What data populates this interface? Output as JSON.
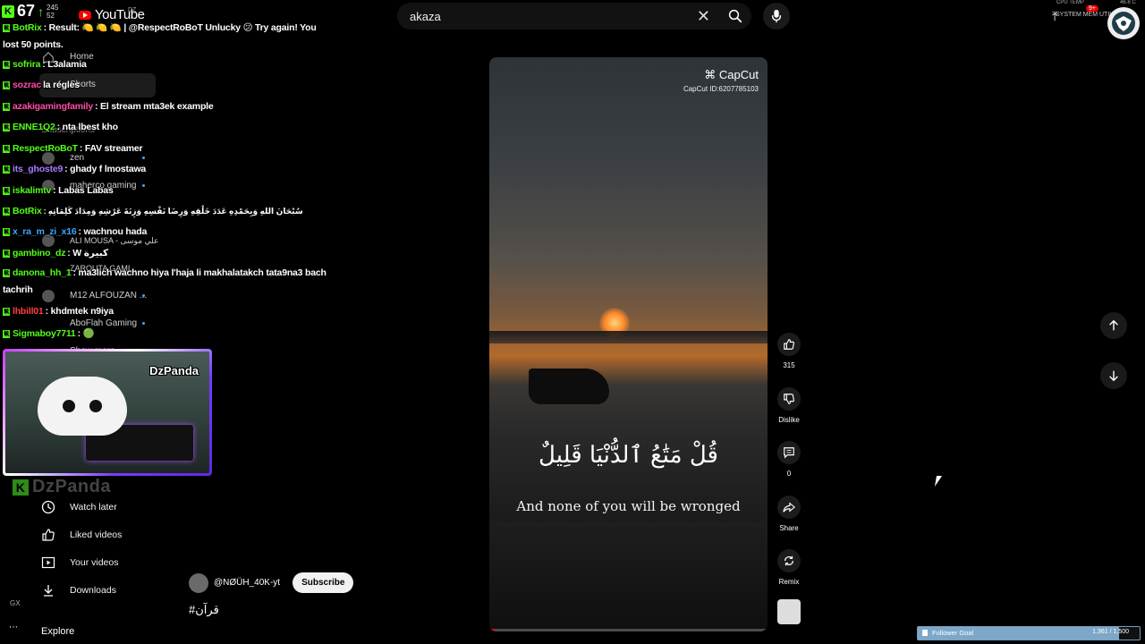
{
  "kick": {
    "count": "67",
    "sub1": "245",
    "sub2": "52"
  },
  "header": {
    "logo": "YouTube",
    "country": "DZ",
    "search_value": "akaza",
    "sysmon_cpu": "CPU TEMP",
    "sysmon_label": "SYSTEM MEM UTIL",
    "notif_count": "9+",
    "temp": "46.8 C"
  },
  "sidebar": {
    "home": "Home",
    "shorts": "Shorts",
    "subscriptions": "Subscriptions",
    "subs": [
      "zen",
      "maherco gaming",
      "ALI MOUSA - علي موسى",
      "ZAROUTA GAMI...",
      "M12 ALFOUZAN ...",
      "AboFlah Gaming"
    ],
    "show_more": "Show more",
    "watch_later": "Watch later",
    "liked": "Liked videos",
    "your_videos": "Your videos",
    "downloads": "Downloads",
    "explore": "Explore"
  },
  "chat": [
    {
      "user": "BotRix",
      "text": ": Result: 🍋 🍋 🍋 | @RespectRoBoT Unlucky 😕 Try again! You lost 50 points.",
      "color": "#53fc18"
    },
    {
      "user": "sofrira",
      "text": ": L3alamia",
      "color": "#53fc18"
    },
    {
      "user": "sozrac",
      "text": "la régles",
      "color": "#ff4da6"
    },
    {
      "user": "azakigamingfamily",
      "text": ": El stream mta3ek example",
      "color": "#ff4da6"
    },
    {
      "user": "ENNE1Q2",
      "text": ": nta lbest kho",
      "color": "#53fc18"
    },
    {
      "user": "RespectRoBoT",
      "text": ": FAV streamer",
      "color": "#53fc18"
    },
    {
      "user": "its_ghoste9",
      "text": ": ghady f lmostawa",
      "color": "#a97bff"
    },
    {
      "user": "iskalimtv",
      "text": ": Labas Labas",
      "color": "#53fc18"
    },
    {
      "user": "BotRix",
      "text": ": سُبْحَانَ اللهِ وَبِحَمْدِهِ عَدَدَ خَلْقِهِ وَرِضَا نَفْسِهِ وَزِنَةَ عَرْشِهِ وَمِدَادَ كَلِمَاتِهِ",
      "color": "#53fc18"
    },
    {
      "user": "x_ra_m_zi_x16",
      "text": ": wachnou hada",
      "color": "#3ea6ff"
    },
    {
      "user": "gambino_dz",
      "text": ": W كبيرة",
      "color": "#53fc18"
    },
    {
      "user": "danona_hh_1",
      "text": ": ma3lich wachno hiya l'haja li makhalatakch tata9na3 bach tachrih",
      "color": "#53fc18"
    },
    {
      "user": "lhbill01",
      "text": ": khdmtek n9iya",
      "color": "#ff4040"
    },
    {
      "user": "Sigmaboy7711",
      "text": ": 🟢",
      "color": "#53fc18"
    }
  ],
  "cam": {
    "name": "DzPanda",
    "watermark": "DzPanda"
  },
  "video": {
    "brand": "CapCut",
    "capcut_id": "CapCut ID:6207785103",
    "arabic": "قُلْ مَتَٰعُ ٱلدُّنْيَا قَلِيلٌ",
    "subtitle": "And none of you will be wronged",
    "progress": 0.02
  },
  "actions": {
    "likes": "315",
    "dislike": "Dislike",
    "comments": "0",
    "share": "Share",
    "remix": "Remix"
  },
  "channel": {
    "name": "@NØÜH_40K-yt",
    "subscribe": "Subscribe",
    "tag": "#قرآن"
  },
  "follower_goal": {
    "label": "Follower Goal",
    "count": "1,361 / 1,500",
    "progress": 0.907
  },
  "misc": {
    "gx": "GX"
  }
}
